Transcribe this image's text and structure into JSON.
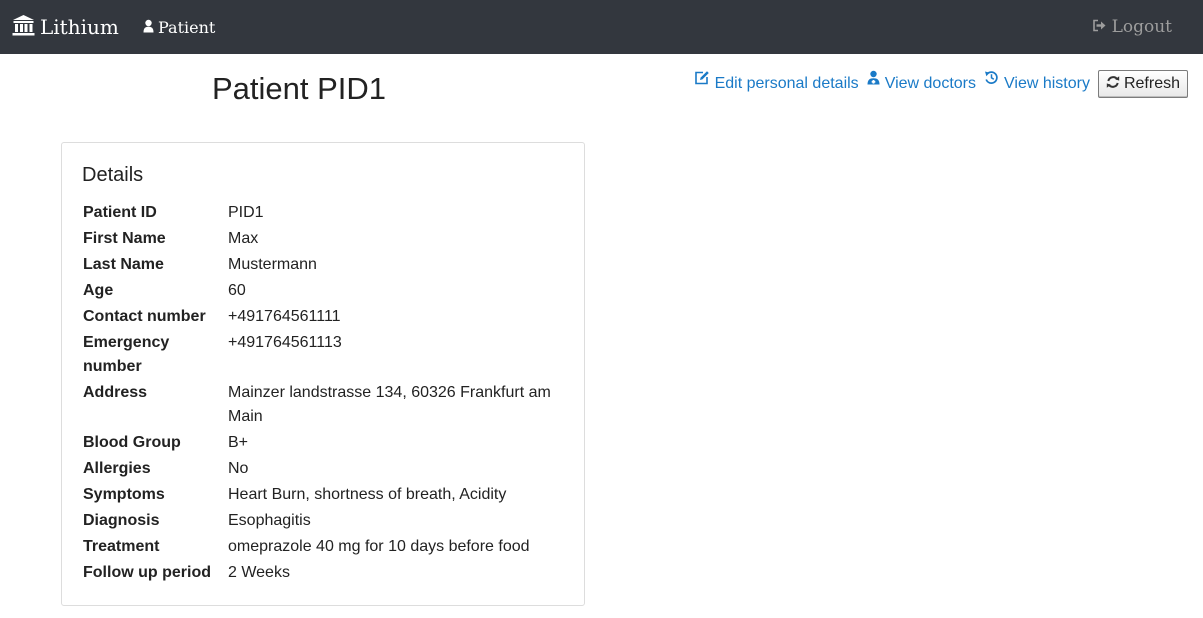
{
  "navbar": {
    "brand": "Lithium",
    "patient_link": "Patient",
    "logout": "Logout"
  },
  "page": {
    "title": "Patient PID1"
  },
  "actions": {
    "edit": "Edit personal details",
    "doctors": "View doctors",
    "history": "View history",
    "refresh": "Refresh"
  },
  "panel": {
    "title": "Details",
    "rows": [
      {
        "label": "Patient ID",
        "value": "PID1"
      },
      {
        "label": "First Name",
        "value": "Max"
      },
      {
        "label": "Last Name",
        "value": "Mustermann"
      },
      {
        "label": "Age",
        "value": "60"
      },
      {
        "label": "Contact number",
        "value": "+491764561111"
      },
      {
        "label": "Emergency number",
        "value": "+491764561113"
      },
      {
        "label": "Address",
        "value": "Mainzer landstrasse 134, 60326 Frankfurt am Main"
      },
      {
        "label": "Blood Group",
        "value": "B+"
      },
      {
        "label": "Allergies",
        "value": "No"
      },
      {
        "label": "Symptoms",
        "value": "Heart Burn, shortness of breath, Acidity"
      },
      {
        "label": "Diagnosis",
        "value": "Esophagitis"
      },
      {
        "label": "Treatment",
        "value": "omeprazole 40 mg for 10 days before food"
      },
      {
        "label": "Follow up period",
        "value": "2 Weeks"
      }
    ]
  },
  "colors": {
    "navbar_bg": "#33373e",
    "link": "#1a7ac7",
    "logout": "#9d9d9d"
  },
  "icons": {
    "brand": "bank-icon",
    "patient": "user-icon",
    "logout": "logout-icon",
    "edit": "edit-icon",
    "doctors": "user-md-icon",
    "history": "history-icon",
    "refresh": "refresh-icon"
  }
}
